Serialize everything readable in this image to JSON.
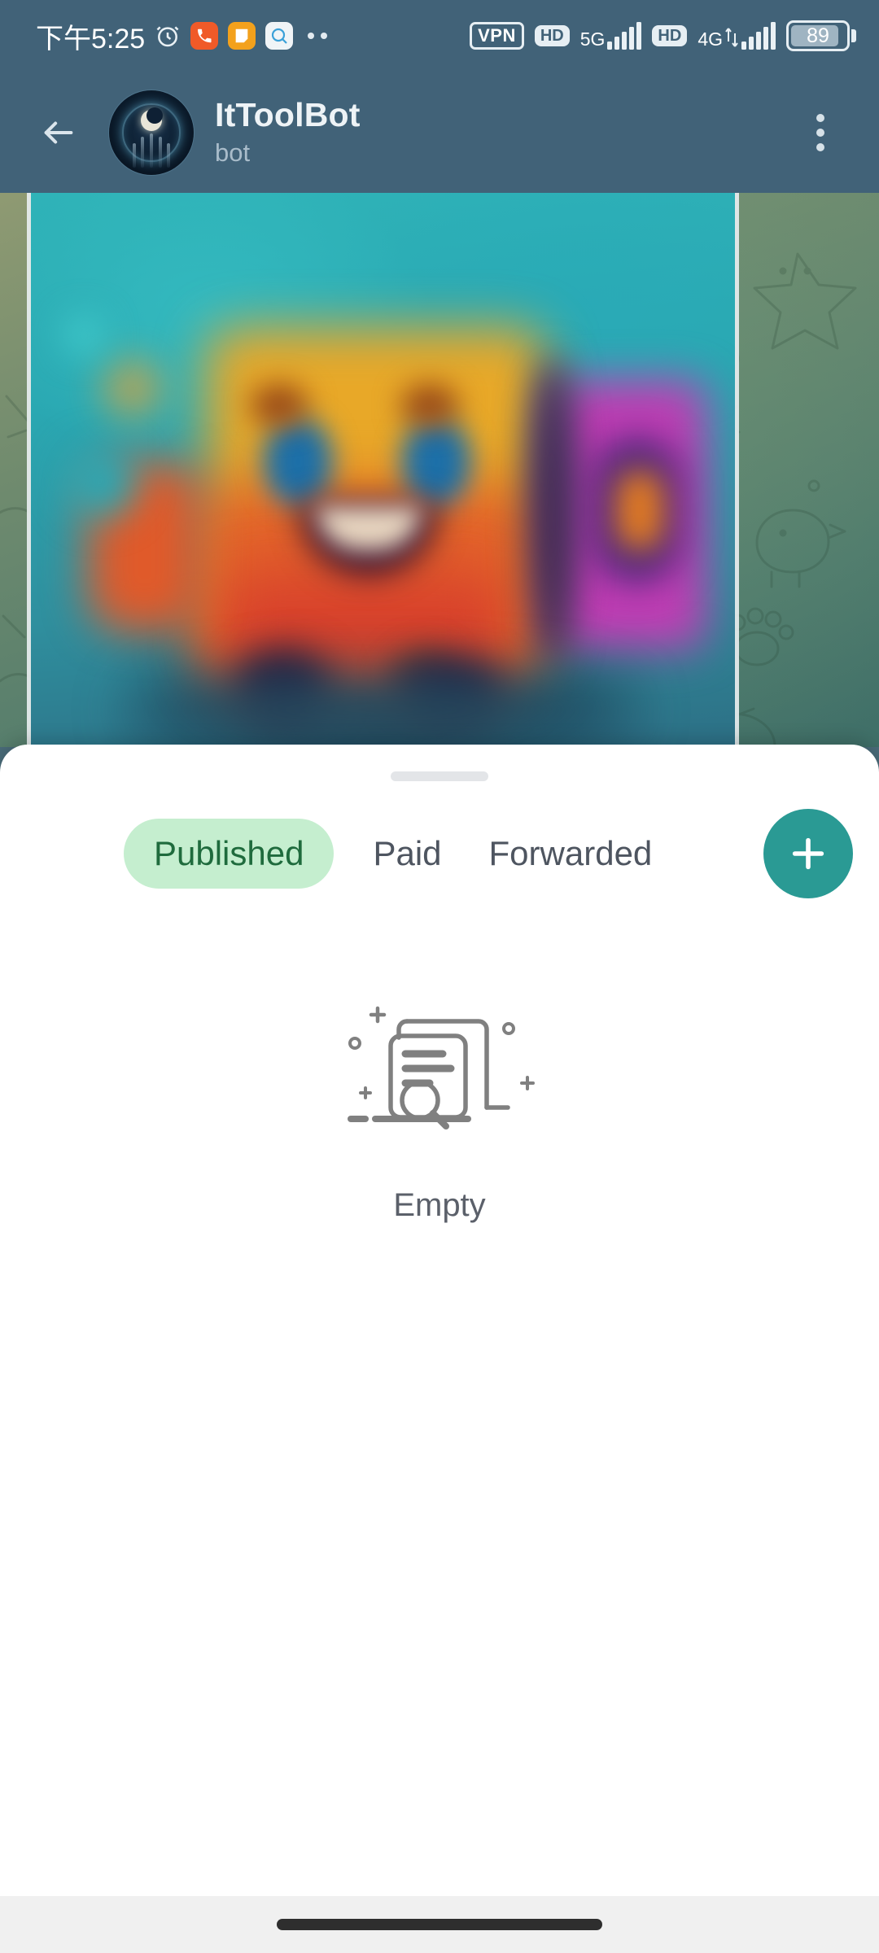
{
  "status_bar": {
    "time": "下午5:25",
    "alarm_icon": "alarm-clock-icon",
    "notification_icons": [
      "phone-app-icon",
      "note-app-icon",
      "chat-app-icon"
    ],
    "overflow_dots": "more-notifications-icon",
    "vpn_label": "VPN",
    "hd_label_1": "HD",
    "network_1": "5G",
    "hd_label_2": "HD",
    "network_2": "4G",
    "battery_percent": "89"
  },
  "app_bar": {
    "back_icon": "back-arrow-icon",
    "avatar_icon": "bot-avatar",
    "title": "ItToolBot",
    "subtitle": "bot",
    "menu_icon": "overflow-menu-icon"
  },
  "chat": {
    "wallpaper": "telegram-doodle-wallpaper",
    "message_image": "blurred-robot-artwork"
  },
  "sheet": {
    "grabber": "sheet-drag-handle",
    "tabs": [
      {
        "label": "Published",
        "selected": true
      },
      {
        "label": "Paid",
        "selected": false
      },
      {
        "label": "Forwarded",
        "selected": false
      }
    ],
    "add_button": {
      "icon": "plus-icon",
      "label": "+"
    },
    "empty_state": {
      "illustration": "empty-documents-search-icon",
      "label": "Empty"
    }
  },
  "nav_bar": {
    "gesture_pill": "home-gesture-pill"
  },
  "colors": {
    "app_bar": "#416278",
    "accent_teal": "#2a9a94",
    "tab_pill_bg": "#c5eecf",
    "tab_pill_text": "#1f6b3d",
    "sheet_bg": "#ffffff",
    "empty_text": "#5b606a"
  }
}
